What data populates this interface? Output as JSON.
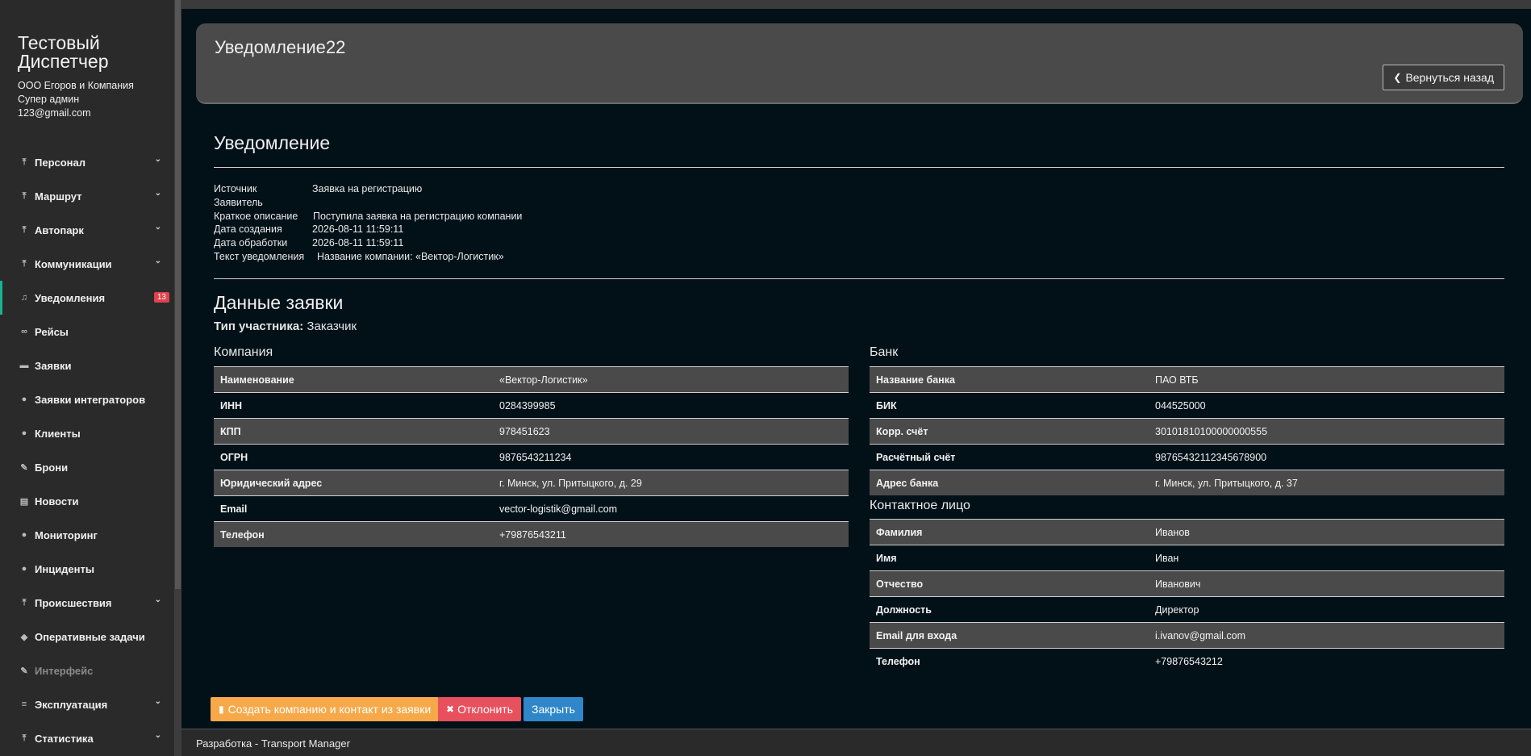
{
  "sidebar": {
    "brand": "Тестовый Диспетчер",
    "company": "ООО Егоров и Компания",
    "role": "Супер админ",
    "email": "123@gmail.com",
    "items": [
      {
        "label": "Персонал",
        "icon": "upload-icon"
      },
      {
        "label": "Маршрут",
        "icon": "upload-icon"
      },
      {
        "label": "Автопарк",
        "icon": "upload-icon"
      },
      {
        "label": "Коммуникации",
        "icon": "upload-icon"
      },
      {
        "label": "Уведомления",
        "icon": "bell-icon",
        "badge": "13"
      },
      {
        "label": "Рейсы",
        "icon": "binoculars-icon"
      },
      {
        "label": "Заявки",
        "icon": "car-icon"
      },
      {
        "label": "Заявки интеграторов",
        "icon": "users-icon"
      },
      {
        "label": "Клиенты",
        "icon": "users-icon"
      },
      {
        "label": "Брони",
        "icon": "edit-icon"
      },
      {
        "label": "Новости",
        "icon": "newspaper-icon"
      },
      {
        "label": "Мониторинг",
        "icon": "map-marker-icon"
      },
      {
        "label": "Инциденты",
        "icon": "map-marker-icon"
      },
      {
        "label": "Происшествия",
        "icon": "upload-icon"
      },
      {
        "label": "Оперативные задачи",
        "icon": "tag-icon"
      },
      {
        "label": "Интерфейс",
        "icon": "edit-icon"
      },
      {
        "label": "Эксплуатация",
        "icon": "list-icon"
      },
      {
        "label": "Статистика",
        "icon": "upload-icon"
      }
    ]
  },
  "header": {
    "title": "Уведомление22",
    "back_label": "Вернуться назад"
  },
  "notification": {
    "heading": "Уведомление",
    "rows": [
      {
        "k": "Источник",
        "v": "Заявка на регистрацию"
      },
      {
        "k": "Заявитель",
        "v": ""
      },
      {
        "k": "Краткое описание",
        "v": "Поступила заявка на регистрацию компании"
      },
      {
        "k": "Дата создания",
        "v": "2026-08-11 11:59:11"
      },
      {
        "k": "Дата обработки",
        "v": "2026-08-11 11:59:11"
      },
      {
        "k": "Текст уведомления",
        "v": "Название компании: «Вектор-Логистик»"
      }
    ]
  },
  "request": {
    "heading": "Данные заявки",
    "participant_label": "Тип участника:",
    "participant_value": "Заказчик",
    "company_heading": "Компания",
    "company_rows": [
      {
        "k": "Наименование",
        "v": "«Вектор-Логистик»"
      },
      {
        "k": "ИНН",
        "v": "0284399985"
      },
      {
        "k": "КПП",
        "v": "978451623"
      },
      {
        "k": "ОГРН",
        "v": "9876543211234"
      },
      {
        "k": "Юридический адрес",
        "v": "г. Минск, ул. Притыцкого, д. 29"
      },
      {
        "k": "Email",
        "v": "vector-logistik@gmail.com"
      },
      {
        "k": "Телефон",
        "v": "+79876543211"
      }
    ],
    "bank_heading": "Банк",
    "bank_rows": [
      {
        "k": "Название банка",
        "v": "ПАО ВТБ"
      },
      {
        "k": "БИК",
        "v": "044525000"
      },
      {
        "k": "Корр. счёт",
        "v": "30101810100000000555"
      },
      {
        "k": "Расчётный счёт",
        "v": "98765432112345678900"
      },
      {
        "k": "Адрес банка",
        "v": "г. Минск, ул. Притыцкого, д. 37"
      }
    ],
    "contact_heading": "Контактное лицо",
    "contact_rows": [
      {
        "k": "Фамилия",
        "v": "Иванов"
      },
      {
        "k": "Имя",
        "v": "Иван"
      },
      {
        "k": "Отчество",
        "v": "Иванович"
      },
      {
        "k": "Должность",
        "v": "Директор"
      },
      {
        "k": "Email для входа",
        "v": "i.ivanov@gmail.com"
      },
      {
        "k": "Телефон",
        "v": "+79876543212"
      }
    ]
  },
  "actions": {
    "create_label": "Создать компанию и контакт из заявки",
    "reject_label": "Отклонить",
    "close_label": "Закрыть"
  },
  "colors": {
    "accent": "#19b394",
    "create": "#f7a94a",
    "reject": "#e8505e",
    "close": "#2f86c9"
  },
  "footer": {
    "text": "Разработка - Transport Manager"
  }
}
